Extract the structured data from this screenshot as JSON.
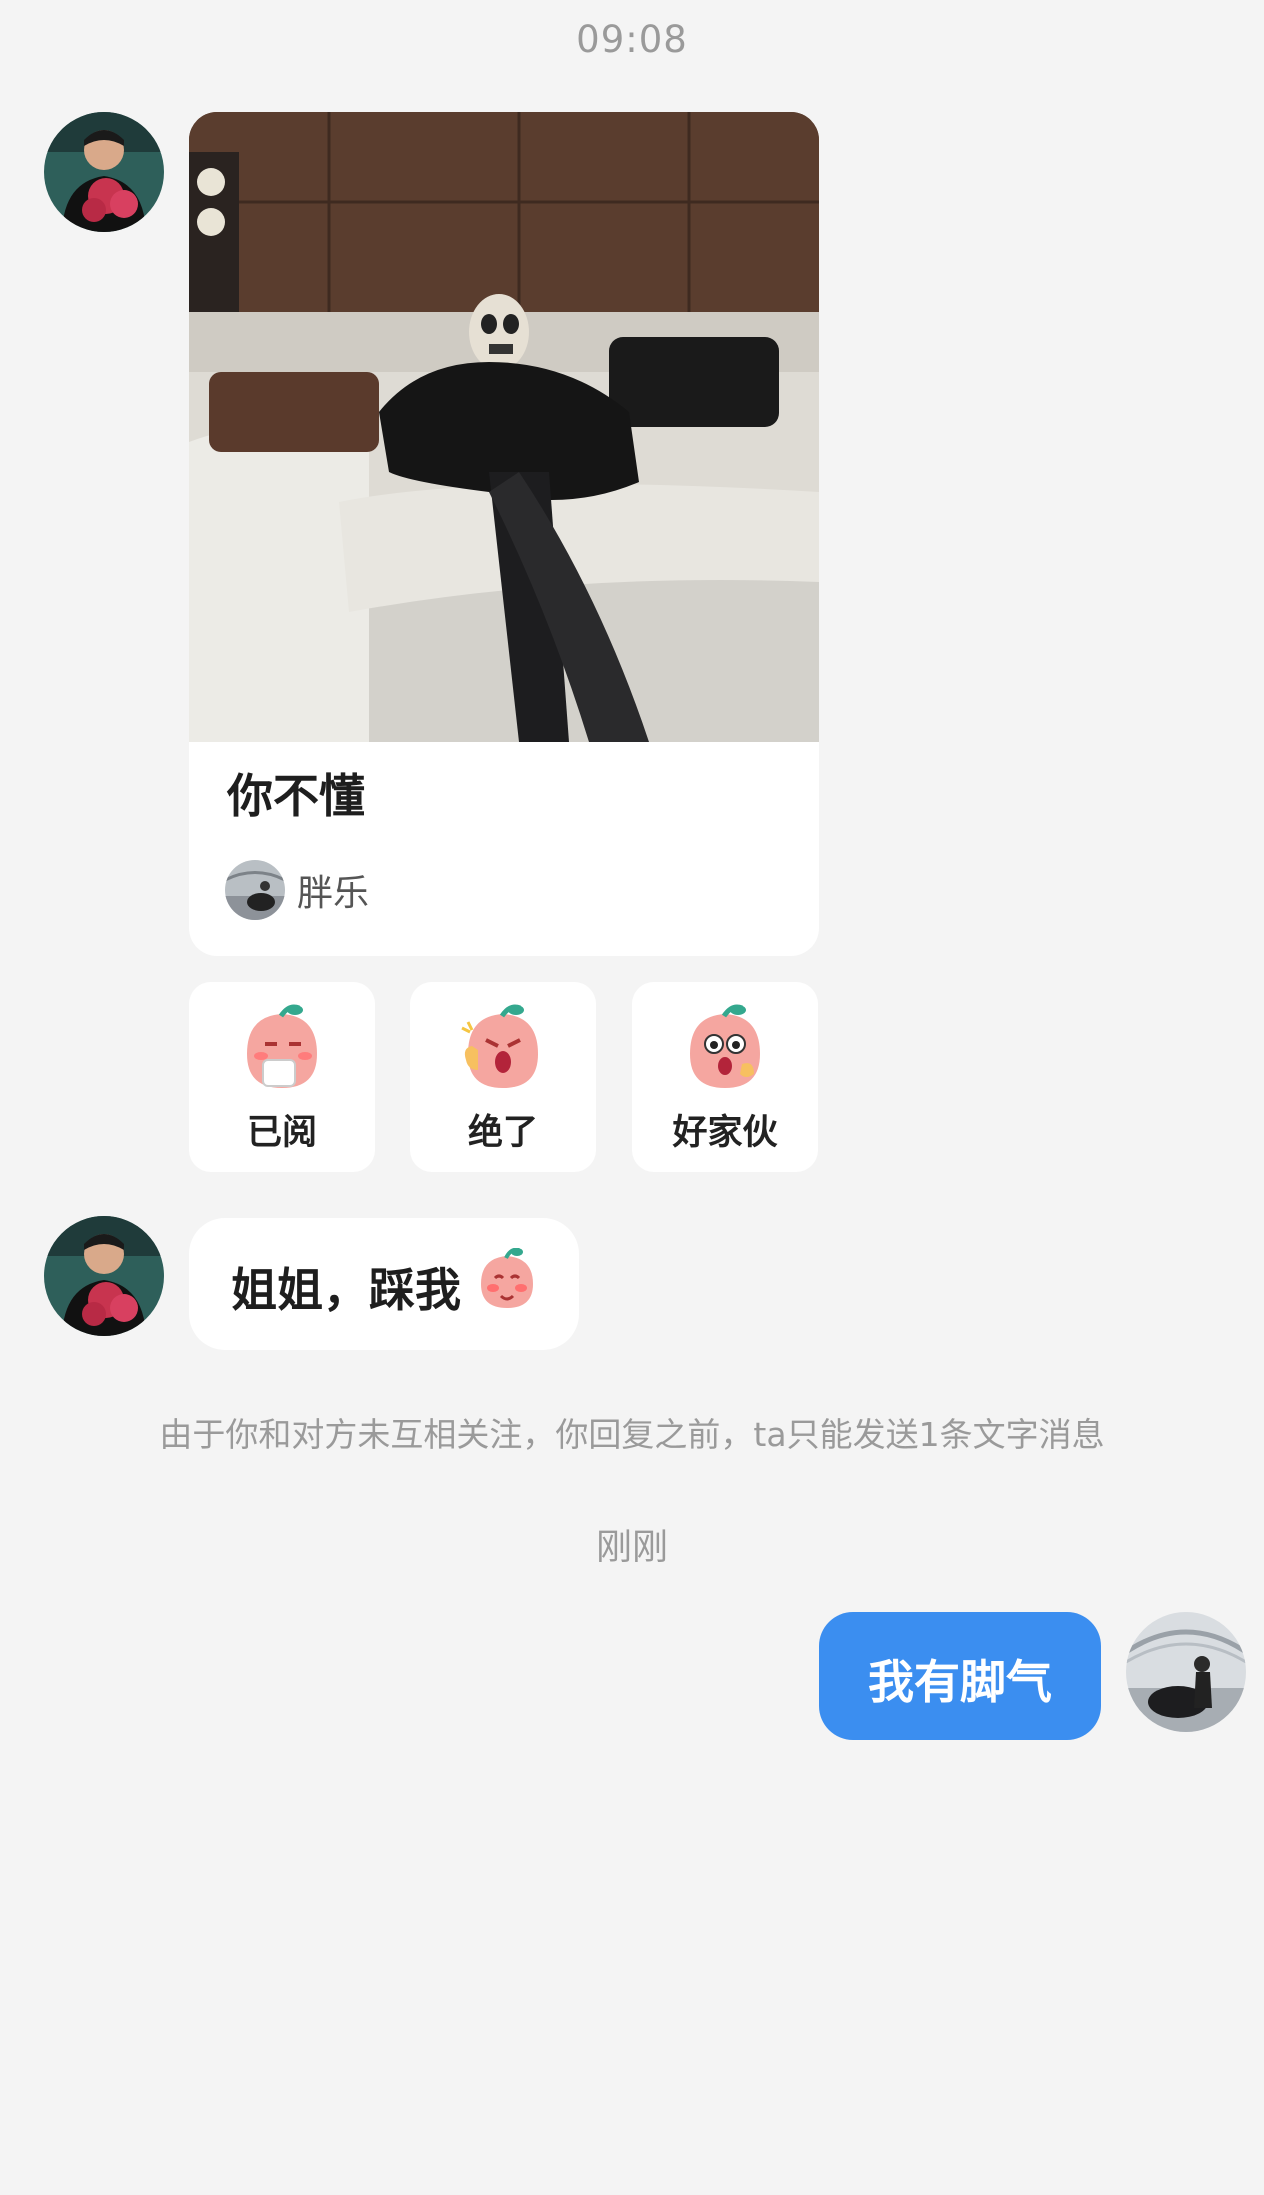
{
  "header": {
    "time": "09:08"
  },
  "post_card": {
    "title": "你不懂",
    "author_name": "胖乐"
  },
  "reactions": [
    {
      "label": "已阅",
      "icon": "peach-tea-emoji-icon"
    },
    {
      "label": "绝了",
      "icon": "peach-thumbs-up-emoji-icon"
    },
    {
      "label": "好家伙",
      "icon": "peach-surprised-emoji-icon"
    }
  ],
  "messages": {
    "incoming_text": "姐姐，踩我",
    "incoming_emoji": "peach-shy-emoji-icon",
    "notice": "由于你和对方未互相关注，你回复之前，ta只能发送1条文字消息",
    "timestamp": "刚刚",
    "outgoing_text": "我有脚气"
  },
  "colors": {
    "background": "#f4f4f4",
    "outgoing_bubble": "#3b8ef0",
    "muted_text": "#9a9a9a"
  }
}
